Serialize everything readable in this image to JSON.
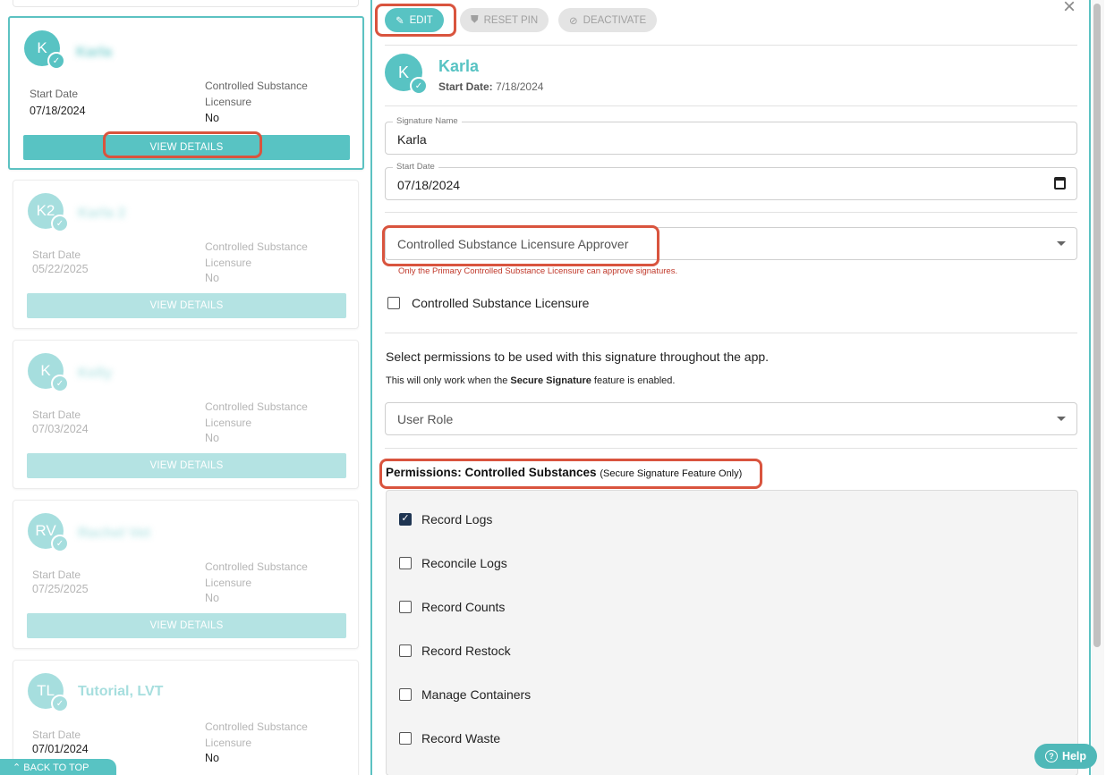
{
  "list": {
    "cards": [
      {
        "initials": "K",
        "name": "Karla",
        "start_label": "Start Date",
        "start_value": "07/18/2024",
        "cs_label_1": "Controlled Substance",
        "cs_label_2": "Licensure",
        "cs_value": "No",
        "button": "VIEW DETAILS"
      },
      {
        "initials": "K2",
        "name": "Karla 2",
        "start_label": "Start Date",
        "start_value": "05/22/2025",
        "cs_label_1": "Controlled Substance",
        "cs_label_2": "Licensure",
        "cs_value": "No",
        "button": "VIEW DETAILS"
      },
      {
        "initials": "K",
        "name": "Kelly",
        "start_label": "Start Date",
        "start_value": "07/03/2024",
        "cs_label_1": "Controlled Substance",
        "cs_label_2": "Licensure",
        "cs_value": "No",
        "button": "VIEW DETAILS"
      },
      {
        "initials": "RV",
        "name": "Rachel Vet",
        "start_label": "Start Date",
        "start_value": "07/25/2025",
        "cs_label_1": "Controlled Substance",
        "cs_label_2": "Licensure",
        "cs_value": "No",
        "button": "VIEW DETAILS"
      },
      {
        "initials": "TL",
        "name": "Tutorial, LVT",
        "start_label": "Start Date",
        "start_value": "07/01/2024",
        "cs_label_1": "Controlled Substance",
        "cs_label_2": "Licensure",
        "cs_value": "No",
        "button": "VIEW DETAILS"
      }
    ],
    "back_to_top": "BACK TO TOP"
  },
  "toolbar": {
    "edit": "EDIT",
    "reset_pin": "RESET PIN",
    "deactivate": "DEACTIVATE",
    "close": "×"
  },
  "detail": {
    "initials": "K",
    "name": "Karla",
    "start_date_label": "Start Date:",
    "start_date_value": "7/18/2024",
    "signature_name_label": "Signature Name",
    "signature_name_value": "Karla",
    "start_date_field_label": "Start Date",
    "start_date_field_value": "07/18/2024",
    "approver_select": "Controlled Substance Licensure Approver",
    "approver_error": "Only the Primary Controlled Substance Licensure can approve signatures.",
    "cs_licensure_checkbox": "Controlled Substance Licensure",
    "permissions_intro": "Select permissions to be used with this signature throughout the app.",
    "secure_note_prefix": "This will only work when the ",
    "secure_note_bold": "Secure Signature",
    "secure_note_suffix": " feature is enabled.",
    "user_role_select": "User Role",
    "perm_title": "Permissions: Controlled Substances",
    "perm_title_note": "(Secure Signature Feature Only)",
    "permissions": [
      {
        "label": "Record Logs",
        "checked": true
      },
      {
        "label": "Reconcile Logs",
        "checked": false
      },
      {
        "label": "Record Counts",
        "checked": false
      },
      {
        "label": "Record Restock",
        "checked": false
      },
      {
        "label": "Manage Containers",
        "checked": false
      },
      {
        "label": "Record Waste",
        "checked": false
      }
    ]
  },
  "help": "Help",
  "colors": {
    "accent": "#58c3c3",
    "highlight": "#d9543e",
    "error": "#c0392b",
    "check": "#1f3552"
  }
}
